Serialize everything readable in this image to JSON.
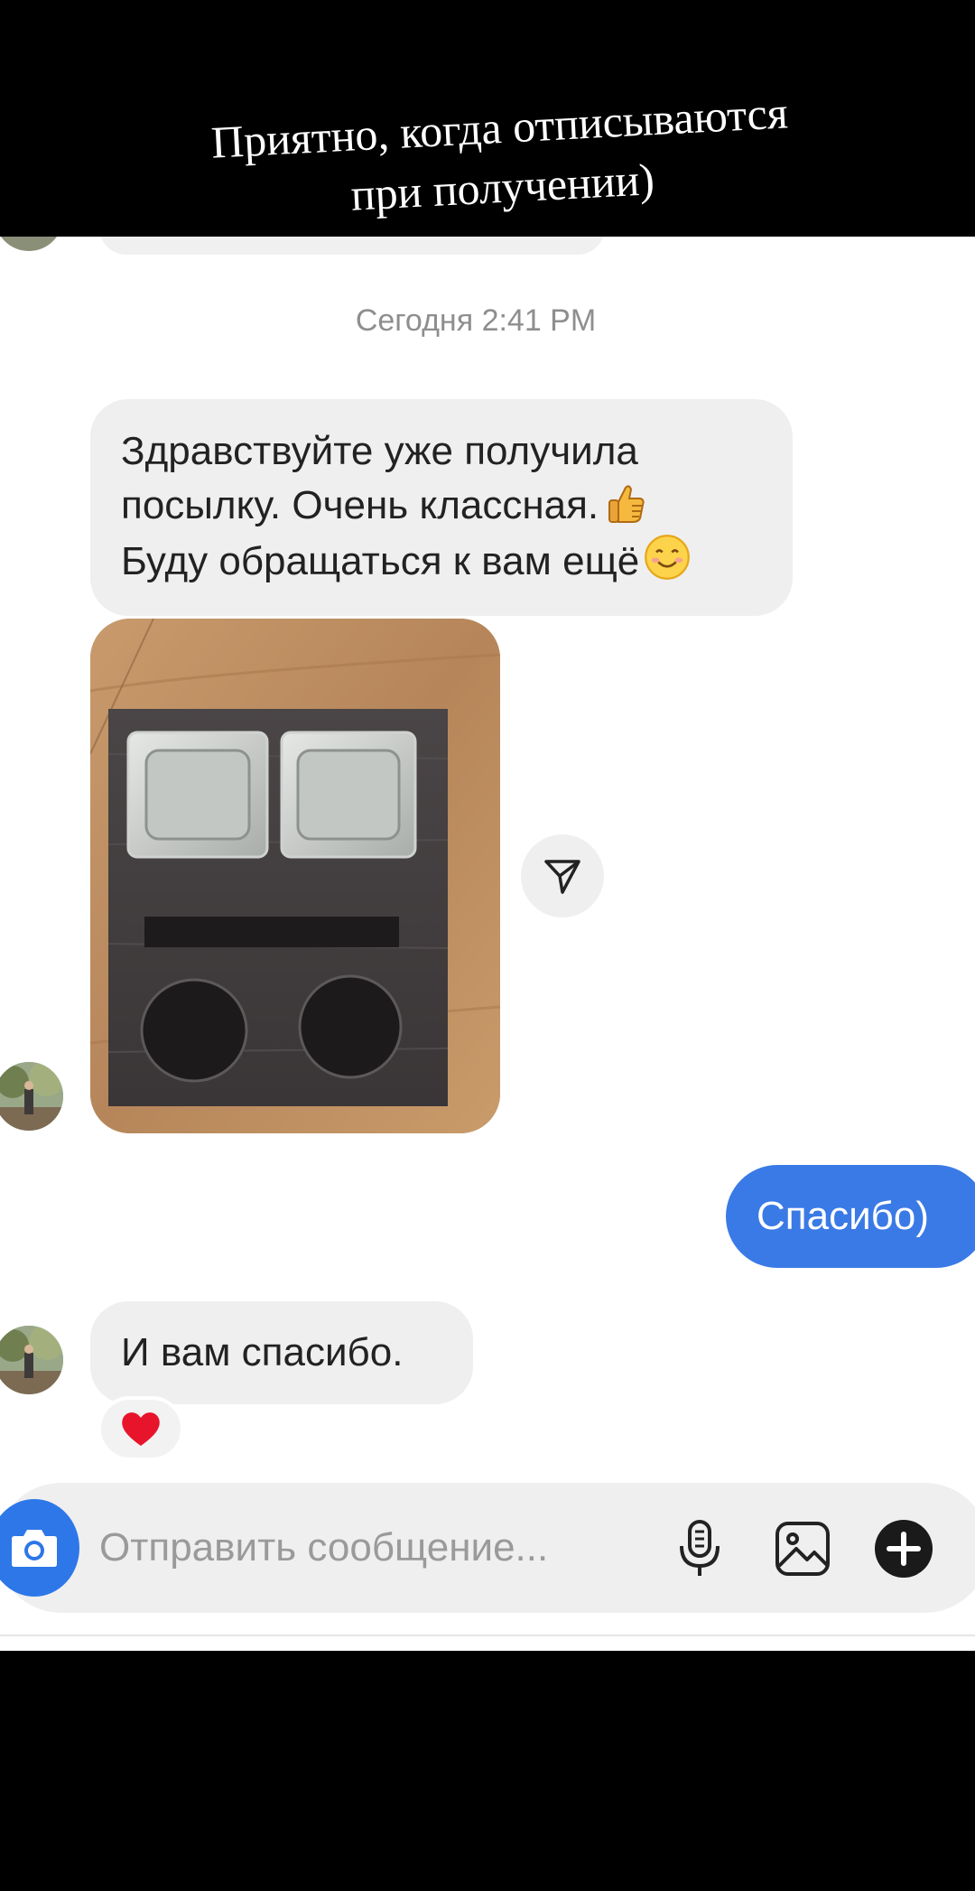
{
  "banner": {
    "caption_line1": "Приятно, когда отписываются",
    "caption_line2": "при получении)"
  },
  "conversation": {
    "timestamp": "Сегодня 2:41 PM",
    "incoming_message_1": {
      "line1": "Здравствуйте уже получила",
      "line2": "посылку. Очень классная.",
      "line3": "Буду обращаться к вам ещё",
      "emojis": [
        "thumbs-up-icon",
        "smiling-face-icon"
      ]
    },
    "outgoing_message": "Спасибо)",
    "incoming_message_2": "И вам спасибо.",
    "reaction": "heart-icon"
  },
  "composer": {
    "placeholder": "Отправить сообщение..."
  },
  "colors": {
    "outgoing_bubble": "#3a7ae6",
    "incoming_bubble": "#efefef",
    "camera_button": "#2d77e8",
    "timestamp_text": "#8e8e8e"
  }
}
